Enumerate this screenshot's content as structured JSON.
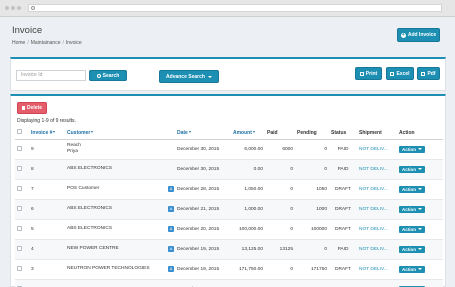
{
  "browser": {
    "url": ""
  },
  "page": {
    "title": "Invoice",
    "breadcrumb": [
      "Home",
      "Maintainance",
      "Invoice"
    ],
    "add_button": "Add Invoice"
  },
  "filters": {
    "search_placeholder": "Invoice Id",
    "search_button": "Search",
    "advance_search": "Advance Search",
    "print": "Print",
    "excel": "Excel",
    "pdf": "Pdf"
  },
  "table": {
    "delete_button": "Delete",
    "displaying": "Displaying 1-9 of 9 results.",
    "columns": [
      "Invoice #",
      "Customer",
      "Date",
      "Amount",
      "Paid",
      "Pending",
      "Status",
      "Shipment",
      "Action"
    ],
    "rows": [
      {
        "invoice": "9",
        "customer": [
          "Reach",
          "Priya"
        ],
        "badge": "",
        "date": "December 30, 2015",
        "amount": "6,000.00",
        "paid": "6000",
        "pending": "0",
        "status": "PAID",
        "shipment": "NOT DELIV...",
        "action": "Action"
      },
      {
        "invoice": "8",
        "customer": [
          "",
          "ABS ELECTRONICS"
        ],
        "badge": "",
        "date": "December 30, 2015",
        "amount": "0.00",
        "paid": "0",
        "pending": "0",
        "status": "PAID",
        "shipment": "NOT DELIV...",
        "action": "Action"
      },
      {
        "invoice": "7",
        "customer": [
          "POS Customer"
        ],
        "badge": "A",
        "date": "December 28, 2015",
        "amount": "1,050.00",
        "paid": "0",
        "pending": "1050",
        "status": "DRAFT",
        "shipment": "NOT DELIV...",
        "action": "Action"
      },
      {
        "invoice": "6",
        "customer": [
          "",
          "ABS ELECTRONICS"
        ],
        "badge": "A",
        "date": "December 21, 2015",
        "amount": "1,000.00",
        "paid": "0",
        "pending": "1000",
        "status": "DRAFT",
        "shipment": "NOT DELIV...",
        "action": "Action"
      },
      {
        "invoice": "5",
        "customer": [
          "",
          "ABS ELECTRONICS"
        ],
        "badge": "A",
        "date": "December 20, 2015",
        "amount": "100,000.00",
        "paid": "0",
        "pending": "100000",
        "status": "DRAFT",
        "shipment": "NOT DELIV...",
        "action": "Action"
      },
      {
        "invoice": "4",
        "customer": [
          "",
          "NEW POWER CENTRE"
        ],
        "badge": "A",
        "date": "December 19, 2015",
        "amount": "13,125.00",
        "paid": "13125",
        "pending": "0",
        "status": "PAID",
        "shipment": "NOT DELIV...",
        "action": "Action"
      },
      {
        "invoice": "3",
        "customer": [
          "",
          "NEUTRON POWER TECHNOLOGIES"
        ],
        "badge": "A",
        "date": "December 19, 2015",
        "amount": "171,750.00",
        "paid": "0",
        "pending": "171750",
        "status": "DRAFT",
        "shipment": "NOT DELIV...",
        "action": "Action"
      },
      {
        "invoice": "",
        "customer": [
          ""
        ],
        "badge": "",
        "date": "December 19, 2015",
        "amount": "",
        "paid": "",
        "pending": "",
        "status": "",
        "shipment": "NOT DELIV...",
        "action": "Action"
      }
    ]
  },
  "colors": {
    "accent": "#1d8fb3",
    "danger": "#e35d6a",
    "link": "#1d6fa5"
  }
}
